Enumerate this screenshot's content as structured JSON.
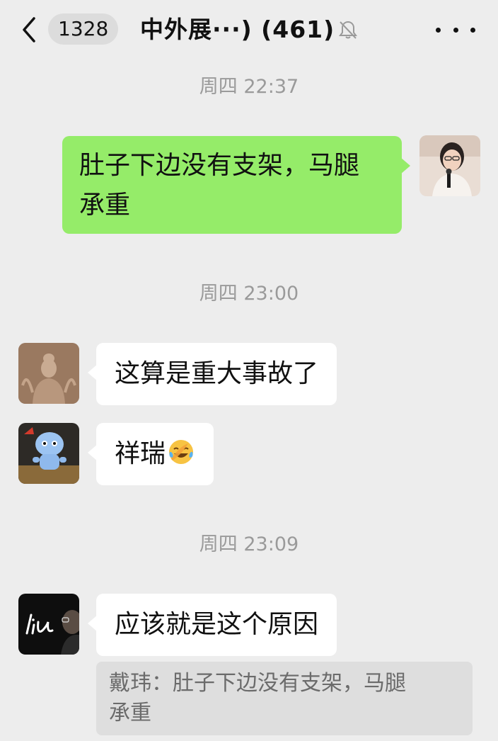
{
  "header": {
    "unread_count": "1328",
    "title": "中外展···) (461)",
    "mute_icon": "bell-slash-icon",
    "more_icon": "more-dots-icon",
    "back_icon": "chevron-left-icon"
  },
  "messages": [
    {
      "timestamp": "周四 22:37"
    },
    {
      "sender": "self",
      "text": "肚子下边没有支架，马腿承重",
      "text_line1": "肚子下边没有支架，马腿",
      "text_line2": "承重"
    },
    {
      "timestamp": "周四 23:00"
    },
    {
      "sender": "other-1",
      "text": "这算是重大事故了"
    },
    {
      "sender": "other-2",
      "text": "祥瑞",
      "emoji": "face-with-tears-of-joy"
    },
    {
      "timestamp": "周四 23:09"
    },
    {
      "sender": "other-3",
      "text": "应该就是这个原因"
    }
  ],
  "quote": {
    "line1": "戴玮：肚子下边没有支架，马腿",
    "line2": "承重"
  },
  "colors": {
    "background": "#ededed",
    "self_bubble": "#95ec69",
    "other_bubble": "#ffffff",
    "timestamp_text": "#9a9a9a",
    "quote_bg": "#dedede"
  }
}
